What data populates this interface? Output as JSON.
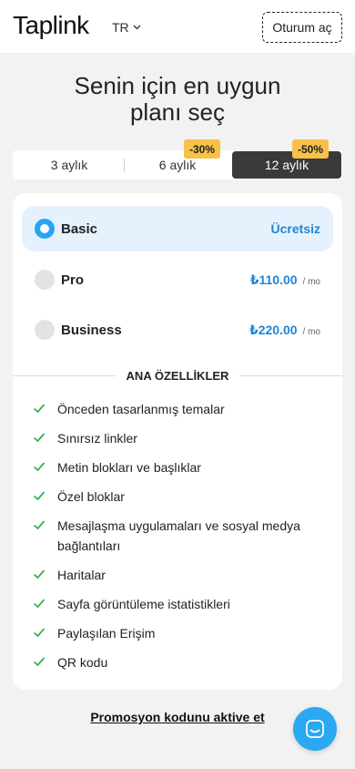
{
  "header": {
    "logo": "Taplink",
    "language": "TR",
    "login_label": "Oturum aç"
  },
  "title": {
    "line1": "Senin için en uygun",
    "line2": "planı seç"
  },
  "periods": [
    {
      "label": "3 aylık",
      "badge": "",
      "selected": false
    },
    {
      "label": "6 aylık",
      "badge": "-30%",
      "selected": false
    },
    {
      "label": "12 aylık",
      "badge": "-50%",
      "selected": true
    }
  ],
  "plans": [
    {
      "name": "Basic",
      "price": "Ücretsiz",
      "unit": "",
      "selected": true
    },
    {
      "name": "Pro",
      "price": "₺110.00",
      "unit": "/ mo",
      "selected": false
    },
    {
      "name": "Business",
      "price": "₺220.00",
      "unit": "/ mo",
      "selected": false
    }
  ],
  "features_title": "ANA ÖZELLİKLER",
  "features": [
    "Önceden tasarlanmış temalar",
    "Sınırsız linkler",
    "Metin blokları ve başlıklar",
    "Özel bloklar",
    "Mesajlaşma uygulamaları ve sosyal medya bağlantıları",
    "Haritalar",
    "Sayfa görüntüleme istatistikleri",
    "Paylaşılan Erişim",
    "QR kodu"
  ],
  "promo_label": "Promosyon kodunu aktive et",
  "icons": {
    "chevron": "chevron-down-icon",
    "check": "check-icon",
    "chat": "chat-icon"
  },
  "colors": {
    "accent": "#2aa3f2",
    "price": "#1e86d8",
    "badge": "#f8c147",
    "check": "#2fb54a",
    "selected_tab": "#3a3a3a"
  }
}
